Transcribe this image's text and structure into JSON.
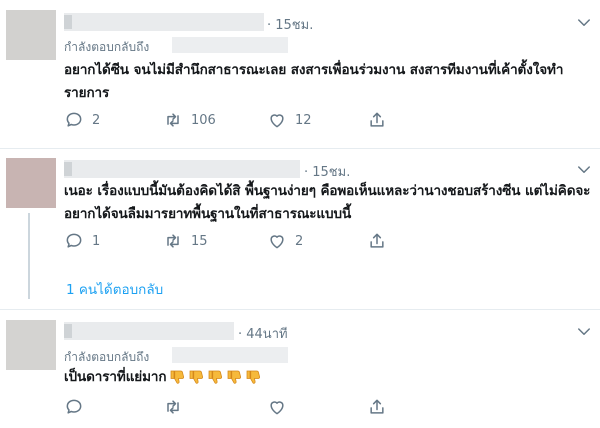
{
  "tweets": [
    {
      "time": "· 15ชม.",
      "reply_label": "กำลังตอบกลับถึง",
      "text": "อยากได้ซีน จนไม่มีสำนึกสาธารณะเลย สงสารเพื่อนร่วมงาน สงสารทีมงานที่เค้าตั้งใจทำรายการ",
      "replies": "2",
      "retweets": "106",
      "likes": "12",
      "avatar_color": "#d2d1cf"
    },
    {
      "time": "· 15ชม.",
      "text": "เนอะ เรื่องแบบนี้มันต้องคิดได้สิ พื้นฐานง่ายๆ คือพอเห็นแหละว่านางชอบสร้างซีน แต่ไม่คิดจะอยากได้จนลืมมารยาทพื้นฐานในที่สาธารณะแบบนี้",
      "replies": "1",
      "retweets": "15",
      "likes": "2",
      "avatar_color": "#c8b4b2"
    },
    {
      "time": "· 44นาที",
      "reply_label": "กำลังตอบกลับถึง",
      "text": "เป็นดาราที่แย่มาก",
      "emoji_count": 5,
      "avatar_color": "#d4d3d1"
    }
  ],
  "show_replies_link": "1 คนได้ตอบกลับ",
  "colors": {
    "link": "#1da1f2",
    "muted": "#657786",
    "divider": "#e6ecf0"
  },
  "icons": [
    "chevron-down-icon",
    "reply-icon",
    "retweet-icon",
    "like-icon",
    "share-icon",
    "thumbs-down-emoji"
  ]
}
